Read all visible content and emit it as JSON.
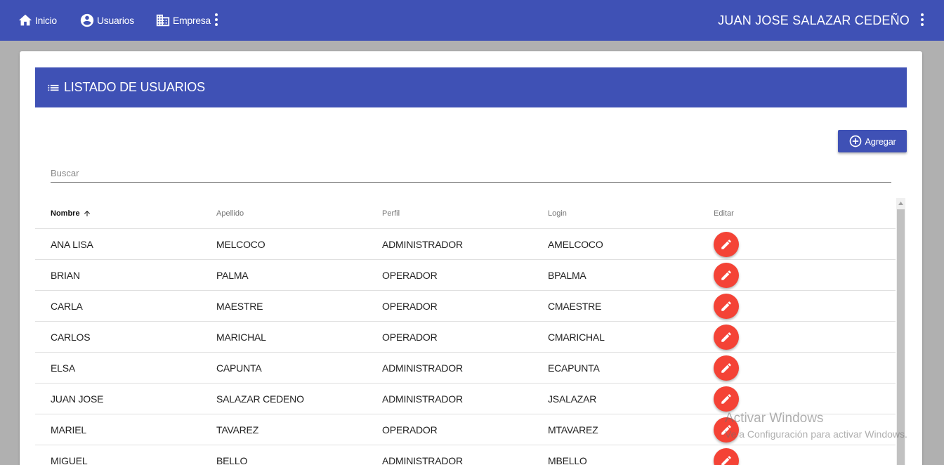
{
  "nav": {
    "inicio": "Inicio",
    "usuarios": "Usuarios",
    "empresa": "Empresa",
    "user_name": "JUAN JOSE SALAZAR CEDEÑO"
  },
  "card": {
    "title": "LISTADO DE USUARIOS",
    "add_label": "Agregar"
  },
  "search": {
    "placeholder": "Buscar"
  },
  "table": {
    "headers": {
      "nombre": "Nombre",
      "apellido": "Apellido",
      "perfil": "Perfil",
      "login": "Login",
      "editar": "Editar"
    },
    "sorted_column": "nombre",
    "sort_direction": "ascending",
    "rows": [
      {
        "nombre": "ANA LISA",
        "apellido": "MELCOCO",
        "perfil": "ADMINISTRADOR",
        "login": "AMELCOCO"
      },
      {
        "nombre": "BRIAN",
        "apellido": "PALMA",
        "perfil": "OPERADOR",
        "login": "BPALMA"
      },
      {
        "nombre": "CARLA",
        "apellido": "MAESTRE",
        "perfil": "OPERADOR",
        "login": "CMAESTRE"
      },
      {
        "nombre": "CARLOS",
        "apellido": "MARICHAL",
        "perfil": "OPERADOR",
        "login": "CMARICHAL"
      },
      {
        "nombre": "ELSA",
        "apellido": "CAPUNTA",
        "perfil": "ADMINISTRADOR",
        "login": "ECAPUNTA"
      },
      {
        "nombre": "JUAN JOSE",
        "apellido": "SALAZAR CEDENO",
        "perfil": "ADMINISTRADOR",
        "login": "JSALAZAR"
      },
      {
        "nombre": "MARIEL",
        "apellido": "TAVAREZ",
        "perfil": "OPERADOR",
        "login": "MTAVAREZ"
      },
      {
        "nombre": "MIGUEL",
        "apellido": "BELLO",
        "perfil": "ADMINISTRADOR",
        "login": "MBELLO"
      }
    ]
  },
  "watermark": {
    "line1": "Activar Windows",
    "line2": "Ve a Configuración para activar Windows."
  },
  "colors": {
    "primary": "#3f51b5",
    "edit_button": "#f44336",
    "page_background": "#b0b0b0"
  },
  "icons": {
    "inicio": "home-icon",
    "usuarios": "account-circle-icon",
    "empresa": "business-icon",
    "more": "more-vert-icon",
    "title": "list-icon",
    "add": "add-circle-outline-icon",
    "sort": "arrow-upward-icon",
    "edit": "pencil-icon"
  }
}
